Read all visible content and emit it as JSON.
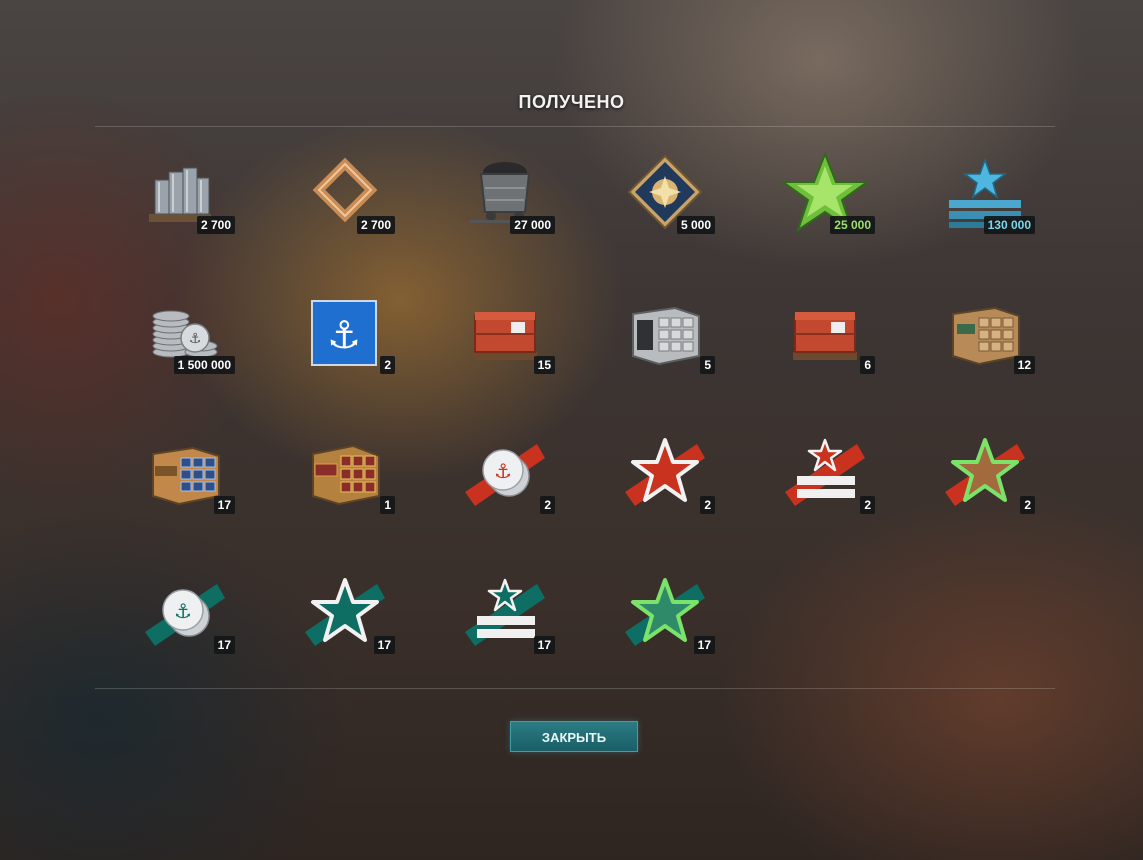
{
  "title": "ПОЛУЧЕНО",
  "close_label": "ЗАКРЫТЬ",
  "rewards": [
    {
      "icon": "steel-icon",
      "count": "2 700"
    },
    {
      "icon": "coal-frame-icon",
      "count": "2 700"
    },
    {
      "icon": "coal-cart-icon",
      "count": "27 000"
    },
    {
      "icon": "research-bureau-medallion-icon",
      "count": "5 000"
    },
    {
      "icon": "elite-commander-xp-icon",
      "count": "25 000",
      "count_color": "#9fe070"
    },
    {
      "icon": "free-xp-icon",
      "count": "130 000",
      "count_color": "#7dd8ec"
    },
    {
      "icon": "credits-icon",
      "count": "1 500 000"
    },
    {
      "icon": "port-slot-icon",
      "count": "2"
    },
    {
      "icon": "red-container-icon",
      "count": "15"
    },
    {
      "icon": "gray-container-icon",
      "count": "5"
    },
    {
      "icon": "red-container-icon",
      "count": "6"
    },
    {
      "icon": "tan-container-icon",
      "count": "12"
    },
    {
      "icon": "blue-drawer-container-icon",
      "count": "17"
    },
    {
      "icon": "gold-drawer-container-icon",
      "count": "1"
    },
    {
      "icon": "red-credits-booster-icon",
      "count": "2"
    },
    {
      "icon": "red-xp-booster-icon",
      "count": "2"
    },
    {
      "icon": "red-commander-xp-booster-icon",
      "count": "2"
    },
    {
      "icon": "red-free-xp-booster-icon",
      "count": "2"
    },
    {
      "icon": "teal-credits-booster-icon",
      "count": "17"
    },
    {
      "icon": "teal-xp-booster-icon",
      "count": "17"
    },
    {
      "icon": "teal-commander-xp-booster-icon",
      "count": "17"
    },
    {
      "icon": "teal-free-xp-booster-icon",
      "count": "17"
    }
  ]
}
